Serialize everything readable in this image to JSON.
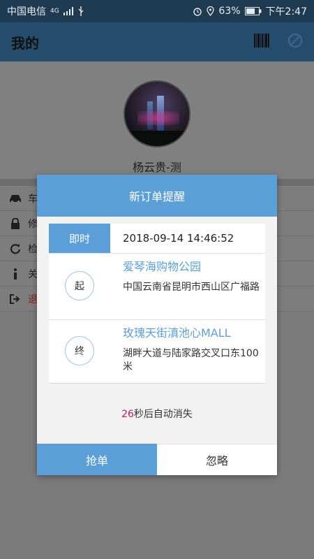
{
  "status_bar": {
    "carrier": "中国电信",
    "network": "4G",
    "battery": "63%",
    "time": "下午2:47"
  },
  "app_bar": {
    "title": "我的",
    "icons": [
      "barcode-icon",
      "block-icon"
    ]
  },
  "profile": {
    "username": "杨云贵-测"
  },
  "menu": {
    "items": [
      {
        "icon": "car-icon",
        "label": "车"
      },
      {
        "icon": "lock-icon",
        "label": "修"
      },
      {
        "icon": "refresh-icon",
        "label": "检"
      },
      {
        "icon": "info-icon",
        "label": "关"
      },
      {
        "icon": "logout-icon",
        "label": "退"
      }
    ]
  },
  "dialog": {
    "title": "新订单提醒",
    "order_type": "即时",
    "datetime": "2018-09-14 14:46:52",
    "start": {
      "badge": "起",
      "name": "爱琴海购物公园",
      "address": "中国云南省昆明市西山区广福路"
    },
    "end": {
      "badge": "终",
      "name": "玫瑰天街滇池心MALL",
      "address": "湖畔大道与陆家路交叉口东100米"
    },
    "countdown_seconds": "26",
    "countdown_suffix": "秒后自动消失",
    "accept_label": "抢单",
    "ignore_label": "忽略"
  },
  "colors": {
    "accent": "#5a9fd8",
    "appbar": "#244d6e",
    "statusbar": "#1f3b52",
    "countdown_number": "#c2185b",
    "logout_text": "#8a1e1e"
  }
}
